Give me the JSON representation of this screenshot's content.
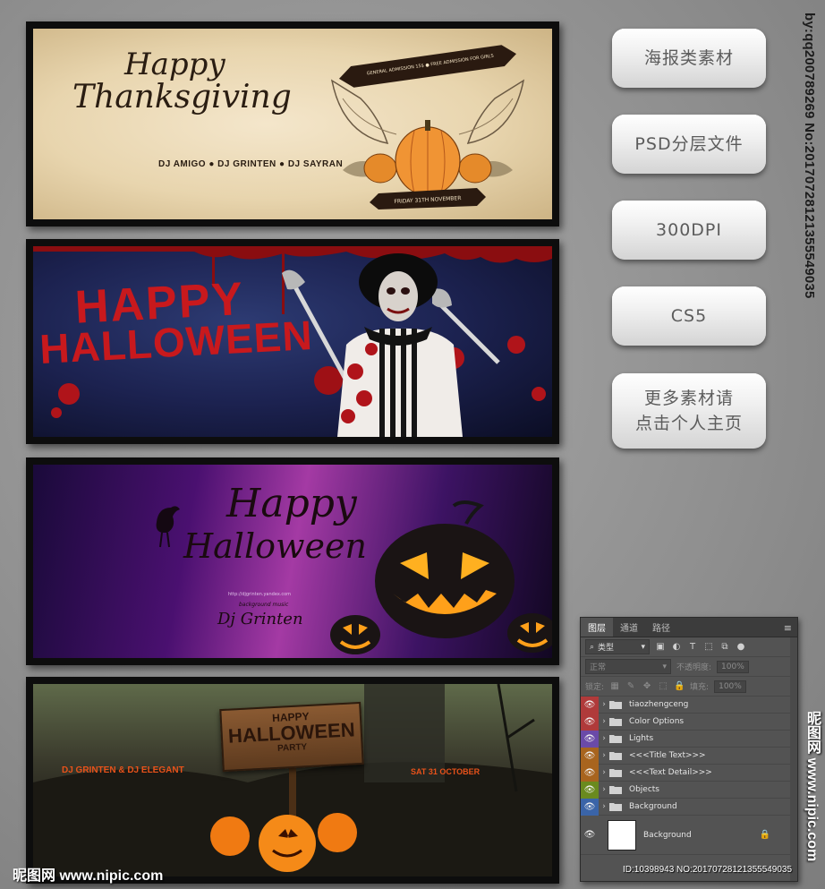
{
  "posters": {
    "thanksgiving": {
      "title_line1": "Happy",
      "title_line2": "Thanksgiving",
      "djs": "DJ AMIGO ● DJ GRINTEN ● DJ SAYRAN",
      "banner_top": "GENERAL ADMISSION 15$ ● FREE ADMISSION FOR GIRLS",
      "banner_bottom": "FRIDAY 31TH NOVEMBER"
    },
    "halloween_blue": {
      "title_line1": "HAPPY",
      "title_line2": "HALLOWEEN"
    },
    "halloween_purple": {
      "title_line1": "Happy",
      "title_line2": "Halloween",
      "url": "http://djgrinten.yandex.com",
      "music_label": "background music",
      "dj": "Dj Grinten"
    },
    "halloween_party": {
      "sign_line1": "HAPPY",
      "sign_line2": "HALLOWEEN",
      "sign_line3": "PARTY",
      "left_text": "DJ GRINTEN  & DJ ELEGANT",
      "right_text": "SAT 31 OCTOBER"
    }
  },
  "info_buttons": [
    "海报类素材",
    "PSD分层文件",
    "300DPI",
    "CS5",
    "更多素材请\n点击个人主页"
  ],
  "vertical_id": "by:qq20078926​9 No:20170728121355549035",
  "layers_panel": {
    "tabs": [
      "图层",
      "通道",
      "路径"
    ],
    "filter_kind": "类型",
    "blend_mode": "正常",
    "opacity_label": "不透明度:",
    "opacity_value": "100%",
    "lock_label": "锁定:",
    "fill_label": "填充:",
    "fill_value": "100%",
    "layers": [
      {
        "name": "tiaozhengceng",
        "color": "#b03a3a"
      },
      {
        "name": "Color Options",
        "color": "#b03a3a"
      },
      {
        "name": "Lights",
        "color": "#6a4aa8"
      },
      {
        "name": "<<<Title Text>>>",
        "color": "#a8641e"
      },
      {
        "name": "<<<Text Detail>>>",
        "color": "#a8641e"
      },
      {
        "name": "Objects",
        "color": "#6a8a1e"
      },
      {
        "name": "Background",
        "color": "#3a64a8"
      }
    ],
    "background_layer": "Background"
  },
  "watermarks": {
    "bottom_left": "昵图网 www.nipic.com",
    "bottom_id": "ID:10398943 NO:20170728121355549035",
    "right_vertical": "昵图网 www.nipic.com"
  },
  "colors": {
    "accent_red": "#c8191d",
    "accent_orange": "#e8521a"
  }
}
